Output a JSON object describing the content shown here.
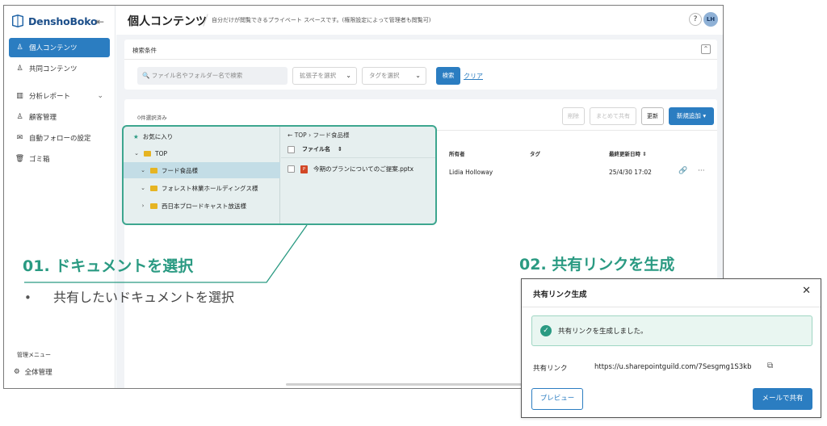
{
  "app": {
    "logo_text": "DenshoBoko"
  },
  "sidebar": {
    "items": [
      {
        "label": "個人コンテンツ"
      },
      {
        "label": "共同コンテンツ"
      },
      {
        "label": "分析レポート"
      },
      {
        "label": "顧客管理"
      },
      {
        "label": "自動フォローの設定"
      },
      {
        "label": "ゴミ箱"
      }
    ],
    "admin_label": "管理メニュー",
    "admin_item": "全体管理"
  },
  "header": {
    "title": "個人コンテンツ",
    "description": "自分だけが閲覧できるプライベート スペースです。(権限設定によって管理者も閲覧可)",
    "help": "?",
    "avatar": "LH"
  },
  "search": {
    "header": "検索条件",
    "placeholder": "ファイル名やフォルダー名で検索",
    "ext_select": "拡張子を選択",
    "tag_select": "タグを選択",
    "search_button": "検索",
    "clear_link": "クリア"
  },
  "files": {
    "selected_count": "0件選択済み",
    "delete_button": "削除",
    "share_all_button": "まとめて共有",
    "refresh_button": "更新",
    "add_button": "新規追加",
    "columns": {
      "owner": "所有者",
      "tag": "タグ",
      "updated": "最終更新日時"
    },
    "row": {
      "owner": "Lidia Holloway",
      "updated": "25/4/30 17:02"
    }
  },
  "tree": {
    "favorites": "お気に入り",
    "top": "TOP",
    "folders": [
      "フード食品様",
      "フォレスト林業ホールディングス様",
      "西日本ブロードキャスト放送様"
    ],
    "breadcrumb_top": "TOP",
    "breadcrumb_current": "フード食品様",
    "file_header": "ファイル名",
    "file_name": "今期のプランについてのご提案.pptx"
  },
  "steps": {
    "step1": "01. ドキュメントを選択",
    "bullet": "共有したいドキュメントを選択",
    "step2": "02. 共有リンクを生成"
  },
  "dialog": {
    "title": "共有リンク生成",
    "success": "共有リンクを生成しました。",
    "link_label": "共有リンク",
    "link_url": "https://u.sharepointguild.com/7Sesgmg1S3kb",
    "preview_button": "プレビュー",
    "mail_button": "メールで共有"
  },
  "colors": {
    "accent": "#2b7dc1",
    "teal": "#2a9a82"
  }
}
